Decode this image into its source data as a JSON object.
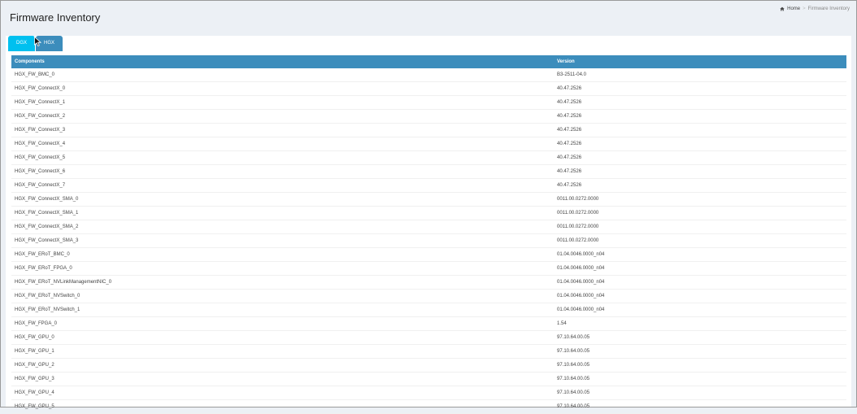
{
  "header": {
    "title": "Firmware Inventory"
  },
  "breadcrumb": {
    "home": "Home",
    "current": "Firmware Inventory"
  },
  "tabs": [
    {
      "label": "DGX",
      "active": true
    },
    {
      "label": "HGX",
      "active": false
    }
  ],
  "table": {
    "columns": [
      "Components",
      "Version"
    ],
    "rows": [
      [
        "HGX_FW_BMC_0",
        "B3-2511-04.0"
      ],
      [
        "HGX_FW_ConnectX_0",
        "40.47.2526"
      ],
      [
        "HGX_FW_ConnectX_1",
        "40.47.2526"
      ],
      [
        "HGX_FW_ConnectX_2",
        "40.47.2526"
      ],
      [
        "HGX_FW_ConnectX_3",
        "40.47.2526"
      ],
      [
        "HGX_FW_ConnectX_4",
        "40.47.2526"
      ],
      [
        "HGX_FW_ConnectX_5",
        "40.47.2526"
      ],
      [
        "HGX_FW_ConnectX_6",
        "40.47.2526"
      ],
      [
        "HGX_FW_ConnectX_7",
        "40.47.2526"
      ],
      [
        "HGX_FW_ConnectX_SMA_0",
        "0011.00.0272.0000"
      ],
      [
        "HGX_FW_ConnectX_SMA_1",
        "0011.00.0272.0000"
      ],
      [
        "HGX_FW_ConnectX_SMA_2",
        "0011.00.0272.0000"
      ],
      [
        "HGX_FW_ConnectX_SMA_3",
        "0011.00.0272.0000"
      ],
      [
        "HGX_FW_ERoT_BMC_0",
        "01.04.0046.0000_n04"
      ],
      [
        "HGX_FW_ERoT_FPGA_0",
        "01.04.0046.0000_n04"
      ],
      [
        "HGX_FW_ERoT_NVLinkManagementNIC_0",
        "01.04.0046.0000_n04"
      ],
      [
        "HGX_FW_ERoT_NVSwitch_0",
        "01.04.0046.0000_n04"
      ],
      [
        "HGX_FW_ERoT_NVSwitch_1",
        "01.04.0046.0000_n04"
      ],
      [
        "HGX_FW_FPGA_0",
        "1.54"
      ],
      [
        "HGX_FW_GPU_0",
        "97.10.64.00.05"
      ],
      [
        "HGX_FW_GPU_1",
        "97.10.64.00.05"
      ],
      [
        "HGX_FW_GPU_2",
        "97.10.64.00.05"
      ],
      [
        "HGX_FW_GPU_3",
        "97.10.64.00.05"
      ],
      [
        "HGX_FW_GPU_4",
        "97.10.64.00.05"
      ],
      [
        "HGX_FW_GPU_5",
        "97.10.64.00.05"
      ]
    ]
  },
  "icons": {
    "home": "home-icon",
    "cursor": "mouse-cursor-icon"
  }
}
